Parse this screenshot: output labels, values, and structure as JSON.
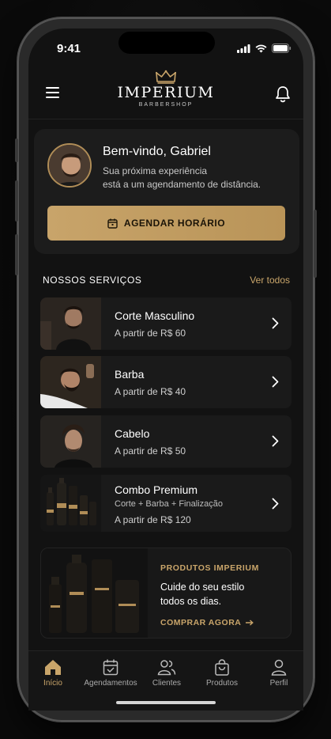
{
  "status_bar": {
    "time": "9:41"
  },
  "header": {
    "brand": "IMPERIUM",
    "brand_sub": "BARBERSHOP"
  },
  "welcome": {
    "title": "Bem-vindo, Gabriel",
    "subtitle_line1": "Sua próxima experiência",
    "subtitle_line2": "está a um agendamento de distância.",
    "cta_label": "AGENDAR HORÁRIO"
  },
  "services_section": {
    "title": "NOSSOS SERVIÇOS",
    "see_all": "Ver todos"
  },
  "services": [
    {
      "name": "Corte Masculino",
      "description": "",
      "price": "A partir de R$ 60",
      "icon": "haircut-photo"
    },
    {
      "name": "Barba",
      "description": "",
      "price": "A partir de R$ 40",
      "icon": "beard-photo"
    },
    {
      "name": "Cabelo",
      "description": "",
      "price": "A partir de R$ 50",
      "icon": "hair-photo"
    },
    {
      "name": "Combo Premium",
      "description": "Corte + Barba + Finalização",
      "price": "A partir de R$ 120",
      "icon": "products-photo"
    }
  ],
  "promo": {
    "tag": "PRODUTOS IMPERIUM",
    "text_line1": "Cuide do seu estilo",
    "text_line2": "todos os dias.",
    "link": "COMPRAR AGORA"
  },
  "tabs": [
    {
      "label": "Início",
      "icon": "home-icon",
      "active": true
    },
    {
      "label": "Agendamentos",
      "icon": "calendar-icon",
      "active": false
    },
    {
      "label": "Clientes",
      "icon": "users-icon",
      "active": false
    },
    {
      "label": "Produtos",
      "icon": "bag-icon",
      "active": false
    },
    {
      "label": "Perfil",
      "icon": "user-icon",
      "active": false
    }
  ],
  "colors": {
    "accent": "#c9a56a",
    "background": "#121212",
    "card": "#1c1c1c",
    "cta": "#c8a46a"
  }
}
